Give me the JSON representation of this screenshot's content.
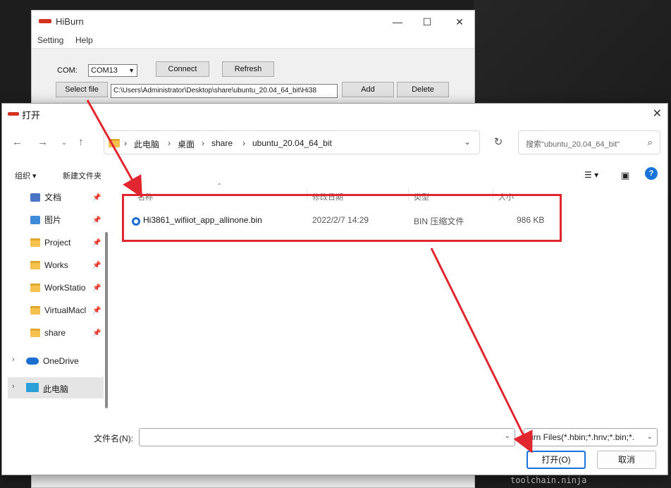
{
  "hiburn": {
    "title": "HiBurn",
    "menu": [
      "Setting",
      "Help"
    ],
    "com_label": "COM:",
    "com_value": "COM13",
    "connect_label": "Connect",
    "refresh_label": "Refresh",
    "select_file_label": "Select file",
    "path_value": "C:\\Users\\Administrator\\Desktop\\share\\ubuntu_20.04_64_bit\\Hi38",
    "add_label": "Add",
    "delete_label": "Delete"
  },
  "dialog": {
    "title": "打开",
    "breadcrumb": [
      "此电脑",
      "桌面",
      "share",
      "ubuntu_20.04_64_bit"
    ],
    "search_placeholder": "搜索\"ubuntu_20.04_64_bit\"",
    "toolbar": {
      "organize": "组织 ▾",
      "new_folder": "新建文件夹"
    },
    "sidebar": {
      "quick_access": [
        {
          "label": "文档",
          "icon": "documents-icon"
        },
        {
          "label": "图片",
          "icon": "pictures-icon"
        },
        {
          "label": "Project",
          "icon": "folder-icon"
        },
        {
          "label": "Works",
          "icon": "folder-icon"
        },
        {
          "label": "WorkStatio",
          "icon": "folder-icon"
        },
        {
          "label": "VirtualMacl",
          "icon": "folder-icon"
        },
        {
          "label": "share",
          "icon": "folder-icon"
        }
      ],
      "onedrive": "OneDrive",
      "this_pc": "此电脑"
    },
    "columns": [
      "名称",
      "修改日期",
      "类型",
      "大小"
    ],
    "files": [
      {
        "name": "Hi3861_wifiiot_app_allinone.bin",
        "modified": "2022/2/7 14:29",
        "type": "BIN 压缩文件",
        "size": "986 KB"
      }
    ],
    "filename_label": "文件名(N):",
    "filename_value": "",
    "filetype_value": "urn Files(*.hbin;*.hnv;*.bin;*.",
    "open_label": "打开(O)",
    "cancel_label": "取消"
  },
  "watermark": "toolchain.ninja",
  "colors": {
    "annotation_red": "#e0262e",
    "accent_blue": "#1a73d8"
  }
}
